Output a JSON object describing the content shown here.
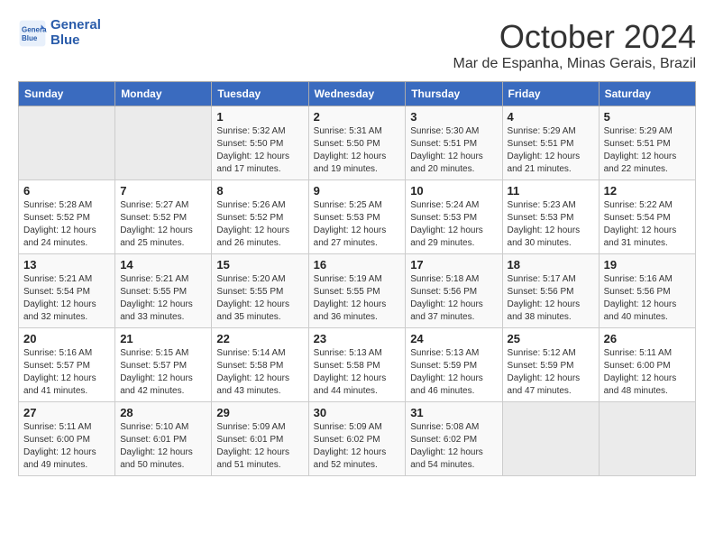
{
  "logo": {
    "line1": "General",
    "line2": "Blue"
  },
  "title": "October 2024",
  "location": "Mar de Espanha, Minas Gerais, Brazil",
  "weekdays": [
    "Sunday",
    "Monday",
    "Tuesday",
    "Wednesday",
    "Thursday",
    "Friday",
    "Saturday"
  ],
  "weeks": [
    [
      {
        "day": "",
        "info": ""
      },
      {
        "day": "",
        "info": ""
      },
      {
        "day": "1",
        "info": "Sunrise: 5:32 AM\nSunset: 5:50 PM\nDaylight: 12 hours\nand 17 minutes."
      },
      {
        "day": "2",
        "info": "Sunrise: 5:31 AM\nSunset: 5:50 PM\nDaylight: 12 hours\nand 19 minutes."
      },
      {
        "day": "3",
        "info": "Sunrise: 5:30 AM\nSunset: 5:51 PM\nDaylight: 12 hours\nand 20 minutes."
      },
      {
        "day": "4",
        "info": "Sunrise: 5:29 AM\nSunset: 5:51 PM\nDaylight: 12 hours\nand 21 minutes."
      },
      {
        "day": "5",
        "info": "Sunrise: 5:29 AM\nSunset: 5:51 PM\nDaylight: 12 hours\nand 22 minutes."
      }
    ],
    [
      {
        "day": "6",
        "info": "Sunrise: 5:28 AM\nSunset: 5:52 PM\nDaylight: 12 hours\nand 24 minutes."
      },
      {
        "day": "7",
        "info": "Sunrise: 5:27 AM\nSunset: 5:52 PM\nDaylight: 12 hours\nand 25 minutes."
      },
      {
        "day": "8",
        "info": "Sunrise: 5:26 AM\nSunset: 5:52 PM\nDaylight: 12 hours\nand 26 minutes."
      },
      {
        "day": "9",
        "info": "Sunrise: 5:25 AM\nSunset: 5:53 PM\nDaylight: 12 hours\nand 27 minutes."
      },
      {
        "day": "10",
        "info": "Sunrise: 5:24 AM\nSunset: 5:53 PM\nDaylight: 12 hours\nand 29 minutes."
      },
      {
        "day": "11",
        "info": "Sunrise: 5:23 AM\nSunset: 5:53 PM\nDaylight: 12 hours\nand 30 minutes."
      },
      {
        "day": "12",
        "info": "Sunrise: 5:22 AM\nSunset: 5:54 PM\nDaylight: 12 hours\nand 31 minutes."
      }
    ],
    [
      {
        "day": "13",
        "info": "Sunrise: 5:21 AM\nSunset: 5:54 PM\nDaylight: 12 hours\nand 32 minutes."
      },
      {
        "day": "14",
        "info": "Sunrise: 5:21 AM\nSunset: 5:55 PM\nDaylight: 12 hours\nand 33 minutes."
      },
      {
        "day": "15",
        "info": "Sunrise: 5:20 AM\nSunset: 5:55 PM\nDaylight: 12 hours\nand 35 minutes."
      },
      {
        "day": "16",
        "info": "Sunrise: 5:19 AM\nSunset: 5:55 PM\nDaylight: 12 hours\nand 36 minutes."
      },
      {
        "day": "17",
        "info": "Sunrise: 5:18 AM\nSunset: 5:56 PM\nDaylight: 12 hours\nand 37 minutes."
      },
      {
        "day": "18",
        "info": "Sunrise: 5:17 AM\nSunset: 5:56 PM\nDaylight: 12 hours\nand 38 minutes."
      },
      {
        "day": "19",
        "info": "Sunrise: 5:16 AM\nSunset: 5:56 PM\nDaylight: 12 hours\nand 40 minutes."
      }
    ],
    [
      {
        "day": "20",
        "info": "Sunrise: 5:16 AM\nSunset: 5:57 PM\nDaylight: 12 hours\nand 41 minutes."
      },
      {
        "day": "21",
        "info": "Sunrise: 5:15 AM\nSunset: 5:57 PM\nDaylight: 12 hours\nand 42 minutes."
      },
      {
        "day": "22",
        "info": "Sunrise: 5:14 AM\nSunset: 5:58 PM\nDaylight: 12 hours\nand 43 minutes."
      },
      {
        "day": "23",
        "info": "Sunrise: 5:13 AM\nSunset: 5:58 PM\nDaylight: 12 hours\nand 44 minutes."
      },
      {
        "day": "24",
        "info": "Sunrise: 5:13 AM\nSunset: 5:59 PM\nDaylight: 12 hours\nand 46 minutes."
      },
      {
        "day": "25",
        "info": "Sunrise: 5:12 AM\nSunset: 5:59 PM\nDaylight: 12 hours\nand 47 minutes."
      },
      {
        "day": "26",
        "info": "Sunrise: 5:11 AM\nSunset: 6:00 PM\nDaylight: 12 hours\nand 48 minutes."
      }
    ],
    [
      {
        "day": "27",
        "info": "Sunrise: 5:11 AM\nSunset: 6:00 PM\nDaylight: 12 hours\nand 49 minutes."
      },
      {
        "day": "28",
        "info": "Sunrise: 5:10 AM\nSunset: 6:01 PM\nDaylight: 12 hours\nand 50 minutes."
      },
      {
        "day": "29",
        "info": "Sunrise: 5:09 AM\nSunset: 6:01 PM\nDaylight: 12 hours\nand 51 minutes."
      },
      {
        "day": "30",
        "info": "Sunrise: 5:09 AM\nSunset: 6:02 PM\nDaylight: 12 hours\nand 52 minutes."
      },
      {
        "day": "31",
        "info": "Sunrise: 5:08 AM\nSunset: 6:02 PM\nDaylight: 12 hours\nand 54 minutes."
      },
      {
        "day": "",
        "info": ""
      },
      {
        "day": "",
        "info": ""
      }
    ]
  ]
}
